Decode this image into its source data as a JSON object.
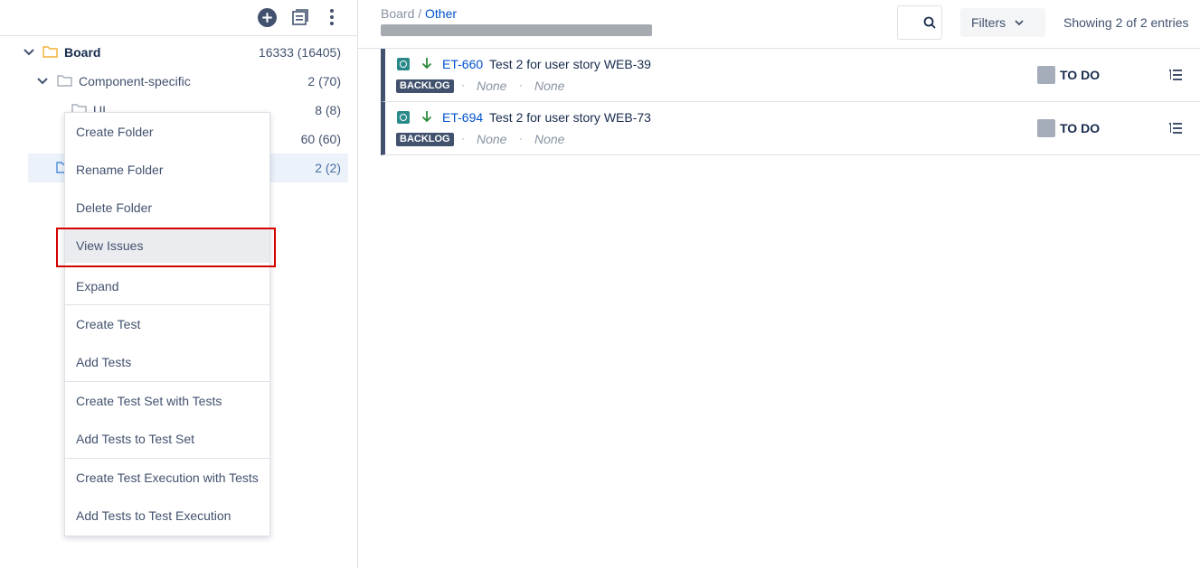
{
  "tree": {
    "items": [
      {
        "label": "Board",
        "count": "16333 (16405)"
      },
      {
        "label": "Component-specific",
        "count": "2 (70)"
      },
      {
        "label": "UI",
        "count": "8 (8)"
      },
      {
        "label": "",
        "count": "60 (60)"
      },
      {
        "label": "",
        "count": "2 (2)"
      }
    ]
  },
  "context_menu": {
    "items": [
      "Create Folder",
      "Rename Folder",
      "Delete Folder",
      "View Issues",
      "Expand",
      "Create Test",
      "Add Tests",
      "Create Test Set with Tests",
      "Add Tests to Test Set",
      "Create Test Execution with Tests",
      "Add Tests to Test Execution"
    ]
  },
  "header": {
    "breadcrumb_root": "Board",
    "breadcrumb_sep": " / ",
    "breadcrumb_current": "Other",
    "filters_label": "Filters",
    "entries_text": "Showing 2 of 2 entries"
  },
  "issues": [
    {
      "key": "ET-660",
      "summary": "Test 2 for user story WEB-39",
      "lozenge": "BACKLOG",
      "dot": "·",
      "field1": "None",
      "field2": "None",
      "status": "TO DO"
    },
    {
      "key": "ET-694",
      "summary": "Test 2 for user story WEB-73",
      "lozenge": "BACKLOG",
      "dot": "·",
      "field1": "None",
      "field2": "None",
      "status": "TO DO"
    }
  ],
  "colors": {
    "accent": "#0052cc",
    "highlight": "#d40000",
    "folder": "#f2b134",
    "test_type": "#2a8a8a",
    "priority_low": "#2a8a3a"
  },
  "icons": [
    "add-circle-icon",
    "view-toggle-icon",
    "more-vertical-icon",
    "chevron-down-icon",
    "folder-icon",
    "search-icon",
    "test-type-icon",
    "priority-low-arrow-icon",
    "list-details-icon"
  ]
}
